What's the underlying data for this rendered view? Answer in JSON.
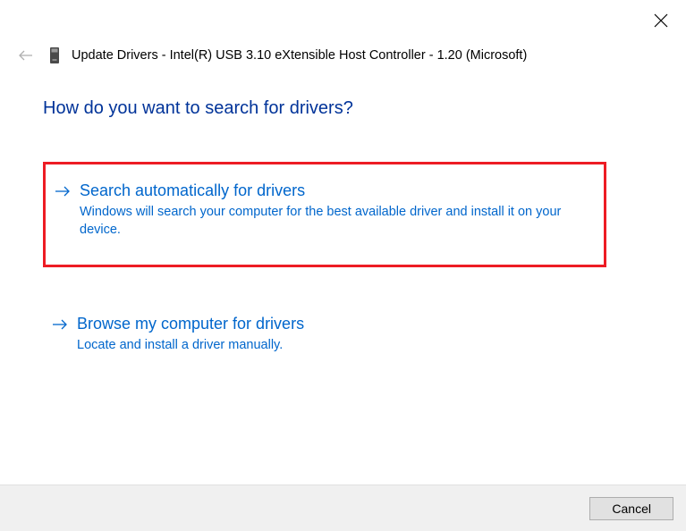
{
  "window": {
    "title": "Update Drivers - Intel(R) USB 3.10 eXtensible Host Controller - 1.20 (Microsoft)"
  },
  "heading": "How do you want to search for drivers?",
  "options": {
    "auto": {
      "title": "Search automatically for drivers",
      "desc": "Windows will search your computer for the best available driver and install it on your device."
    },
    "browse": {
      "title": "Browse my computer for drivers",
      "desc": "Locate and install a driver manually."
    }
  },
  "footer": {
    "cancel": "Cancel"
  }
}
